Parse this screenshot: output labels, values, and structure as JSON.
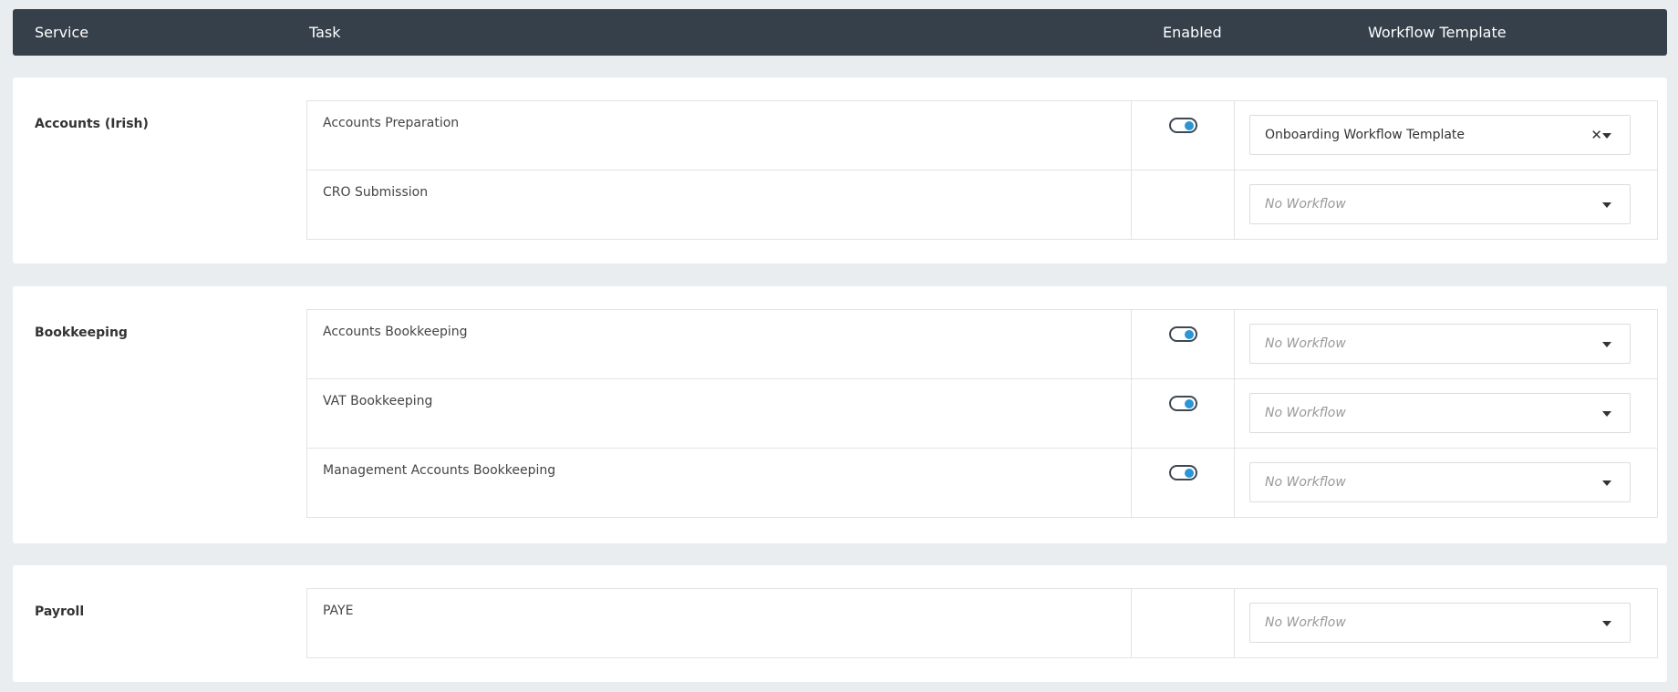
{
  "header": {
    "service": "Service",
    "task": "Task",
    "enabled": "Enabled",
    "workflow_template": "Workflow Template"
  },
  "sections": [
    {
      "name": "Accounts (Irish)",
      "tasks": [
        {
          "name": "Accounts Preparation",
          "enabled": true,
          "workflow": "Onboarding Workflow Template"
        },
        {
          "name": "CRO Submission",
          "enabled": false,
          "workflow_placeholder": "No Workflow"
        }
      ]
    },
    {
      "name": "Bookkeeping",
      "tasks": [
        {
          "name": "Accounts Bookkeeping",
          "enabled": true,
          "workflow_placeholder": "No Workflow"
        },
        {
          "name": "VAT Bookkeeping",
          "enabled": true,
          "workflow_placeholder": "No Workflow"
        },
        {
          "name": "Management Accounts Bookkeeping",
          "enabled": true,
          "workflow_placeholder": "No Workflow"
        }
      ]
    },
    {
      "name": "Payroll",
      "tasks": [
        {
          "name": "PAYE",
          "enabled": false,
          "workflow_placeholder": "No Workflow"
        }
      ]
    }
  ],
  "icons": {
    "clear": "close-icon",
    "dropdown": "chevron-down-icon"
  },
  "colors": {
    "header_bg": "#36404a",
    "page_bg": "#e9edf0",
    "toggle_accent": "#2b95d6"
  }
}
